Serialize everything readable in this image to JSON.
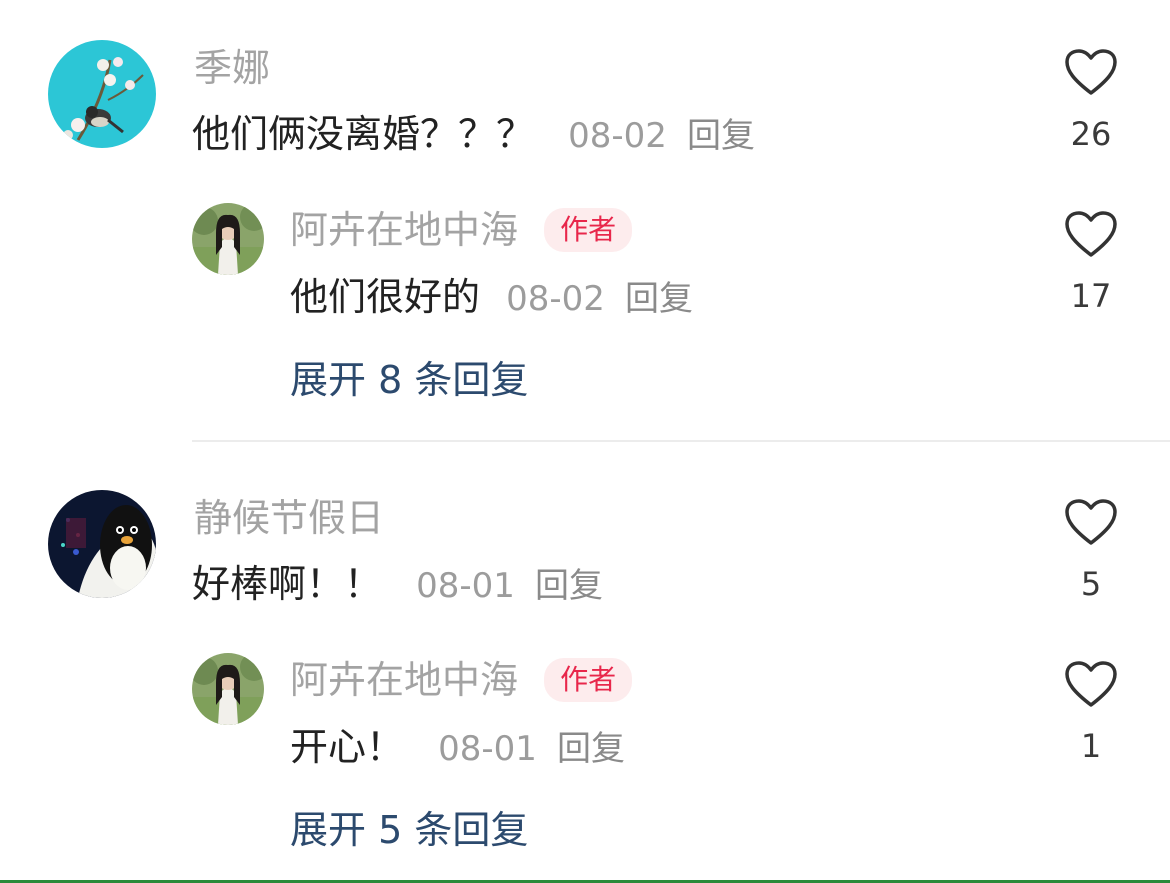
{
  "comments": [
    {
      "username": "季娜",
      "text": "他们俩没离婚？？？",
      "date": "08-02",
      "reply_label": "回复",
      "likes": "26",
      "replies": [
        {
          "username": "阿卉在地中海",
          "badge": "作者",
          "text": "他们很好的",
          "date": "08-02",
          "reply_label": "回复",
          "likes": "17"
        }
      ],
      "expand_label": "展开 8 条回复"
    },
    {
      "username": "静候节假日",
      "text": "好棒啊！！",
      "date": "08-01",
      "reply_label": "回复",
      "likes": "5",
      "replies": [
        {
          "username": "阿卉在地中海",
          "badge": "作者",
          "text": "开心！",
          "date": "08-01",
          "reply_label": "回复",
          "likes": "1"
        }
      ],
      "expand_label": "展开 5 条回复"
    }
  ],
  "colors": {
    "username": "#a3a3a3",
    "meta": "#9c9c9c",
    "badge_text": "#e8274b",
    "badge_bg": "#fdeced",
    "expand_link": "#2c4a6e",
    "divider": "#ececec"
  },
  "icons": {
    "like": "heart-outline-icon"
  }
}
